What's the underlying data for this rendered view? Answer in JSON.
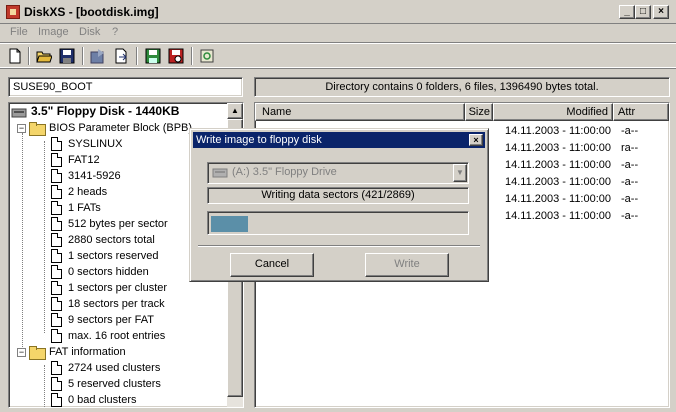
{
  "window": {
    "title": "DiskXS - [bootdisk.img]",
    "min_label": "_",
    "max_label": "□",
    "close_label": "×"
  },
  "menu": {
    "file": "File",
    "image": "Image",
    "disk": "Disk",
    "help": "?"
  },
  "toolbar": {
    "icons": [
      "new-icon",
      "open-icon",
      "save-icon",
      "read-disk-icon",
      "write-disk-icon",
      "save-floppy-icon",
      "format-icon",
      "refresh-icon"
    ]
  },
  "volume_label": "SUSE90_BOOT",
  "status_text": "Directory contains 0 folders, 6 files, 1396490 bytes total.",
  "tree": {
    "root": "3.5\" Floppy Disk - 1440KB",
    "bpb_folder": "BIOS Parameter Block (BPB)",
    "bpb_items": [
      "SYSLINUX",
      "FAT12",
      "3141-5926",
      "2 heads",
      "1 FATs",
      "512 bytes per sector",
      "2880 sectors total",
      "1 sectors reserved",
      "0 sectors hidden",
      "1 sectors per cluster",
      "18 sectors per track",
      "9 sectors per FAT",
      "max. 16 root entries"
    ],
    "fat_folder": "FAT information",
    "fat_items": [
      "2724 used clusters",
      "5 reserved clusters",
      "0 bad clusters"
    ],
    "expand_minus": "−"
  },
  "filelist": {
    "columns": {
      "name": "Name",
      "size": "Size",
      "modified": "Modified",
      "attr": "Attr"
    },
    "rows": [
      {
        "modified": "14.11.2003 - 11:00:00",
        "attr": "-a--"
      },
      {
        "modified": "14.11.2003 - 11:00:00",
        "attr": "ra--"
      },
      {
        "modified": "14.11.2003 - 11:00:00",
        "attr": "-a--"
      },
      {
        "modified": "14.11.2003 - 11:00:00",
        "attr": "-a--"
      },
      {
        "modified": "14.11.2003 - 11:00:00",
        "attr": "-a--"
      },
      {
        "modified": "14.11.2003 - 11:00:00",
        "attr": "-a--"
      }
    ]
  },
  "dialog": {
    "title": "Write image to floppy disk",
    "close_label": "×",
    "drive": "(A:) 3.5\" Floppy Drive",
    "progress_text": "Writing data sectors (421/2869)",
    "progress_fraction": 0.147,
    "cancel_label": "Cancel",
    "write_label": "Write"
  },
  "colors": {
    "dialog_title_bg": "#0a246a",
    "progress_fill": "#5b8fa8"
  }
}
